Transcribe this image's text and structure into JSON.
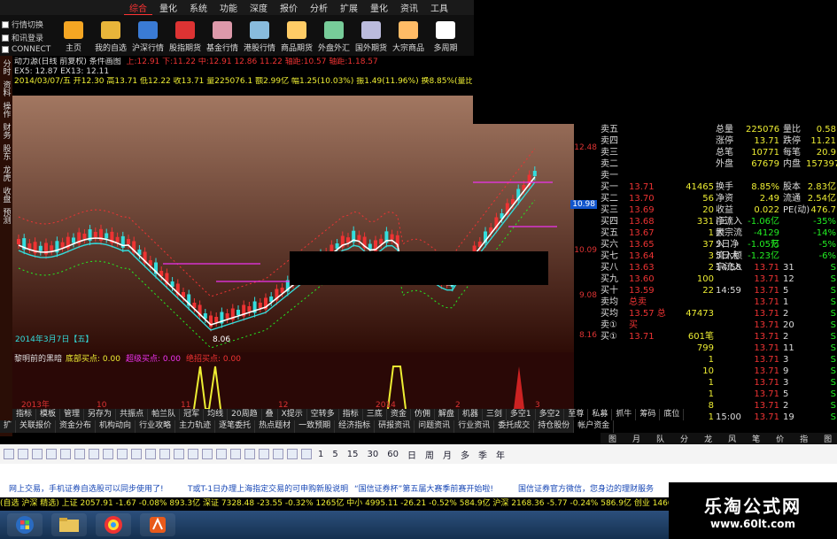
{
  "menu": [
    "综合",
    "量化",
    "系统",
    "功能",
    "深度",
    "报价",
    "分析",
    "扩展",
    "量化",
    "资讯",
    "工具"
  ],
  "menu_active": 0,
  "logins": [
    "行情切换",
    "和讯登录",
    "CONNECT"
  ],
  "toolbar": [
    "主页",
    "我的自选",
    "沪深行情",
    "股指期货",
    "基金行情",
    "港股行情",
    "商品期货",
    "外盘外汇",
    "国外期货",
    "大宗商品",
    "多周期"
  ],
  "leftstrip": [
    "分时",
    "资料",
    "操作",
    "财务",
    "股东",
    "龙虎",
    "收盘",
    "预测"
  ],
  "info": {
    "line1": "动力源(日线 前复权) 条件画图",
    "line1b": "上:12.91  下:11.22  中:12.91  12.86  11.22  轴距:10.57  轴距:1.18.57",
    "line2": "EX5: 12.87   EX13: 12.11",
    "line3": "2014/03/07/五  开12.30  高13.71  低12.22  收13.71  量225076.1  额2.99亿  幅1.25(10.03%)  振1.49(11.96%)  换8.85%(量比0.59)  流通2.54亿  电气设备",
    "date_label": "2014年3月7日【五】",
    "low_label": "8.06"
  },
  "price_axis": [
    "12.48",
    "10.98",
    "10.09",
    "9.08",
    "8.16"
  ],
  "price_current": "10.98",
  "sub": {
    "title": "黎明前的黑暗",
    "a": "底部买点: 0.00",
    "b": "超级买点: 0.00",
    "c": "绝招买点: 0.00"
  },
  "xaxis": [
    "2013年",
    "10",
    "11",
    "12",
    "2014",
    "2",
    "3"
  ],
  "tabs1": [
    "指标",
    "模板",
    "管理",
    "另存为",
    "共振点",
    "帕兰队",
    "冠军",
    "均线",
    "20周趋",
    "叠",
    "X提示",
    "空转多",
    "指标",
    "三底",
    "资金",
    "仿佣",
    "解盘",
    "机器",
    "三剑",
    "多空1",
    "多空2",
    "至尊",
    "私募",
    "抓牛",
    "筹码",
    "底位"
  ],
  "tabs2": [
    "扩",
    "关联报价",
    "资金分布",
    "机构动向",
    "行业攻略",
    "主力轨迹",
    "逐笔委托",
    "热点题材",
    "一致预期",
    "经济指标",
    "研报资讯",
    "问题资讯",
    "行业资讯",
    "委托成交",
    "持仓股份",
    "帐户资金"
  ],
  "rtabs": [
    "图",
    "月",
    "队列",
    "分布",
    "龙虎",
    "风向",
    "笔",
    "价",
    "指",
    "图"
  ],
  "sell_labels": [
    "卖五",
    "卖四",
    "卖三",
    "卖二",
    "卖一"
  ],
  "buy": [
    {
      "l": "买一",
      "p": "13.71",
      "v": "41465"
    },
    {
      "l": "买二",
      "p": "13.70",
      "v": "56"
    },
    {
      "l": "买三",
      "p": "13.69",
      "v": "20"
    },
    {
      "l": "买四",
      "p": "13.68",
      "v": "331"
    },
    {
      "l": "买五",
      "p": "13.67",
      "v": "1"
    },
    {
      "l": "买六",
      "p": "13.65",
      "v": "37"
    },
    {
      "l": "买七",
      "p": "13.64",
      "v": "3"
    },
    {
      "l": "买八",
      "p": "13.63",
      "v": "2"
    },
    {
      "l": "买九",
      "p": "13.60",
      "v": "100"
    },
    {
      "l": "买十",
      "p": "13.59",
      "v": "22"
    }
  ],
  "book_foot": [
    {
      "l": "卖均",
      "p": "",
      "extra": "总卖",
      "v": ""
    },
    {
      "l": "买均",
      "p": "13.57",
      "extra": "总买",
      "v": "47473"
    },
    {
      "l": "卖①",
      "p": "",
      "extra": "",
      "v": ""
    },
    {
      "l": "买①",
      "p": "13.71",
      "extra": "",
      "v": "601笔"
    }
  ],
  "book_bottom": [
    "799",
    "1",
    "10",
    "1",
    "1",
    "8",
    "1"
  ],
  "stats": [
    {
      "a": "总量",
      "b": "225076",
      "c": "量比",
      "d": "0.58"
    },
    {
      "a": "涨停",
      "b": "13.71",
      "c": "跌停",
      "d": "11.21"
    },
    {
      "a": "总笔",
      "b": "10771",
      "c": "每笔",
      "d": "20.9"
    },
    {
      "a": "外盘",
      "b": "67679",
      "c": "内盘",
      "d": "157397"
    },
    {
      "a": "",
      "b": "",
      "c": "",
      "d": ""
    },
    {
      "a": "换手",
      "b": "8.85%",
      "c": "股本",
      "d": "2.83亿"
    },
    {
      "a": "净资",
      "b": "2.49",
      "c": "流通",
      "d": "2.54亿"
    },
    {
      "a": "收益(三)",
      "b": "0.022",
      "c": "PE(动)",
      "d": "476.7"
    }
  ],
  "flows": [
    {
      "a": "净流入额",
      "b": "-1.06亿",
      "d": "-35%"
    },
    {
      "a": "大宗流入",
      "b": "-4129万",
      "d": "-14%"
    },
    {
      "a": "5日净流入额",
      "b": "-1.05亿",
      "d": "-5%"
    },
    {
      "a": "5日大宗流入",
      "b": "-1.23亿",
      "d": "-6%"
    }
  ],
  "ticks": [
    {
      "t": "14:58",
      "p": "13.71",
      "v": "31",
      "s": "S"
    },
    {
      "t": "",
      "p": "13.71",
      "v": "12",
      "s": "S"
    },
    {
      "t": "14:59",
      "p": "13.71",
      "v": "5",
      "s": "S"
    },
    {
      "t": "",
      "p": "13.71",
      "v": "1",
      "s": "S"
    },
    {
      "t": "",
      "p": "13.71",
      "v": "2",
      "s": "S"
    },
    {
      "t": "",
      "p": "13.71",
      "v": "20",
      "s": "S"
    },
    {
      "t": "",
      "p": "13.71",
      "v": "2",
      "s": "S"
    },
    {
      "t": "",
      "p": "13.71",
      "v": "11",
      "s": "S"
    },
    {
      "t": "",
      "p": "13.71",
      "v": "3",
      "s": "S"
    },
    {
      "t": "",
      "p": "13.71",
      "v": "9",
      "s": "S"
    },
    {
      "t": "",
      "p": "13.71",
      "v": "3",
      "s": "S"
    },
    {
      "t": "",
      "p": "13.71",
      "v": "5",
      "s": "S"
    },
    {
      "t": "",
      "p": "13.71",
      "v": "2",
      "s": "S"
    },
    {
      "t": "15:00",
      "p": "13.71",
      "v": "19",
      "s": "S"
    }
  ],
  "periods": [
    "1",
    "5",
    "15",
    "30",
    "60",
    "日",
    "周",
    "月",
    "多",
    "季",
    "年"
  ],
  "ticker": [
    "网上交易，手机证券自选股可以同步使用了!",
    "T或T-1日办理上海指定交易的可申购新股说明",
    "“国信证券杯”第五届大赛季前赛开始啦!",
    "国信证券官方微信，您身边的理财服务"
  ],
  "index_bar": "(自选 沪深 精选)  上证 2057.91  -1.67  -0.08%  893.3亿    深证 7328.48  -23.55  -0.32%  1265亿    中小 4995.11  -26.21  -0.52%  584.9亿    沪深 2168.36  -5.77  -0.24%  586.9亿    创业 1460.61  -11",
  "brand": {
    "name": "乐淘公式网",
    "url": "www.60lt.com"
  },
  "colors": {
    "chart_top": "#a27761",
    "chart_bottom": "#2e0c06",
    "up": "#e33333",
    "down": "#2ecc40",
    "mid": "#33dddd"
  }
}
